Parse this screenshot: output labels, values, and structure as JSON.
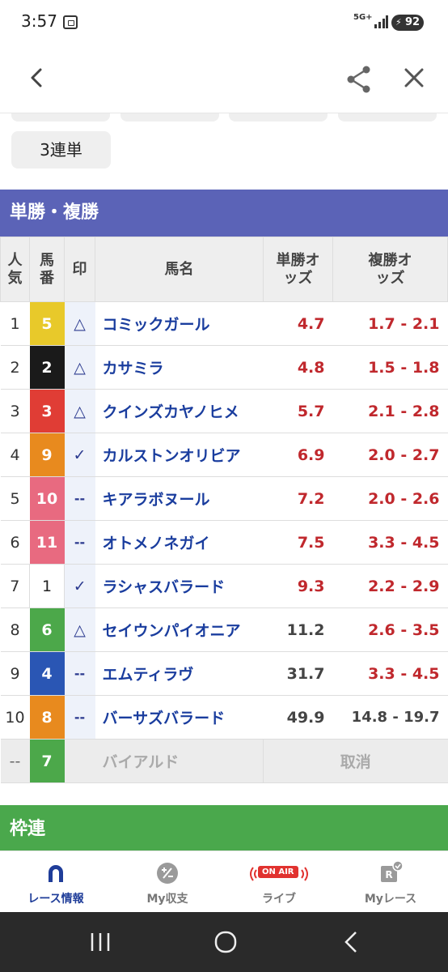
{
  "status": {
    "time": "3:57",
    "network": "5G+",
    "battery": "92"
  },
  "bet_types": {
    "visible_chip": "3連単"
  },
  "win_place": {
    "header": "単勝・複勝",
    "columns": {
      "rank": "人気",
      "number": "馬番",
      "mark": "印",
      "name": "馬名",
      "win": "単勝オッズ",
      "place": "複勝オッズ"
    },
    "rows": [
      {
        "rank": "1",
        "num": "5",
        "color": "#e8c92a",
        "mark": "△",
        "name": "コミックガール",
        "win": "4.7",
        "place": "1.7 - 2.1",
        "win_red": true,
        "place_red": true
      },
      {
        "rank": "2",
        "num": "2",
        "color": "#1a1a1a",
        "mark": "△",
        "name": "カサミラ",
        "win": "4.8",
        "place": "1.5 - 1.8",
        "win_red": true,
        "place_red": true
      },
      {
        "rank": "3",
        "num": "3",
        "color": "#e03d35",
        "mark": "△",
        "name": "クインズカヤノヒメ",
        "win": "5.7",
        "place": "2.1 - 2.8",
        "win_red": true,
        "place_red": true
      },
      {
        "rank": "4",
        "num": "9",
        "color": "#e88a1e",
        "mark": "✓",
        "name": "カルストンオリビア",
        "win": "6.9",
        "place": "2.0 - 2.7",
        "win_red": true,
        "place_red": true
      },
      {
        "rank": "5",
        "num": "10",
        "color": "#e86a80",
        "mark": "--",
        "name": "キアラボヌール",
        "win": "7.2",
        "place": "2.0 - 2.6",
        "win_red": true,
        "place_red": true
      },
      {
        "rank": "6",
        "num": "11",
        "color": "#e86a80",
        "mark": "--",
        "name": "オトメノネガイ",
        "win": "7.5",
        "place": "3.3 - 4.5",
        "win_red": true,
        "place_red": true
      },
      {
        "rank": "7",
        "num": "1",
        "color": "#ffffff",
        "mark": "✓",
        "name": "ラシャスバラード",
        "win": "9.3",
        "place": "2.2 - 2.9",
        "win_red": true,
        "place_red": true
      },
      {
        "rank": "8",
        "num": "6",
        "color": "#4ca84a",
        "mark": "△",
        "name": "セイウンパイオニア",
        "win": "11.2",
        "place": "2.6 - 3.5",
        "win_red": false,
        "place_red": true
      },
      {
        "rank": "9",
        "num": "4",
        "color": "#2a56b4",
        "mark": "--",
        "name": "エムティラヴ",
        "win": "31.7",
        "place": "3.3 - 4.5",
        "win_red": false,
        "place_red": true
      },
      {
        "rank": "10",
        "num": "8",
        "color": "#e88a1e",
        "mark": "--",
        "name": "バーサズバラード",
        "win": "49.9",
        "place": "14.8 - 19.7",
        "win_red": false,
        "place_red": false
      }
    ],
    "scratched": {
      "rank": "--",
      "num": "7",
      "color": "#4ca84a",
      "name": "バイアルド",
      "status": "取消"
    }
  },
  "waku": {
    "header": "枠連"
  },
  "bottom_nav": {
    "items": [
      {
        "label": "レース情報",
        "icon": "horseshoe-icon",
        "active": true
      },
      {
        "label": "My収支",
        "icon": "plus-minus-icon",
        "active": false
      },
      {
        "label": "ライブ",
        "icon": "on-air-icon",
        "badge": "ON AIR",
        "active": false
      },
      {
        "label": "Myレース",
        "icon": "my-race-icon",
        "active": false
      }
    ]
  },
  "colors": {
    "accent_blue": "#5b63b7",
    "accent_green": "#4aa84c",
    "odds_red": "#c0282d",
    "name_blue": "#1a3d9e"
  }
}
